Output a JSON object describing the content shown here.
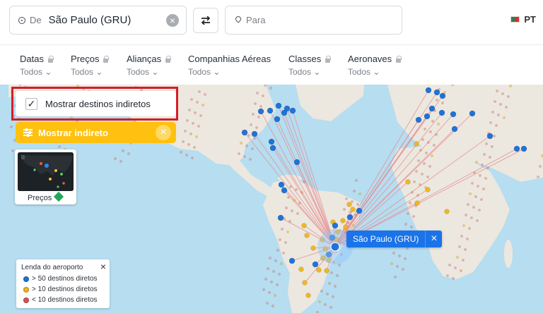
{
  "search": {
    "from_label": "De",
    "from_value": "São Paulo (GRU)",
    "to_placeholder": "Para"
  },
  "language": {
    "code": "PT"
  },
  "filters": [
    {
      "label": "Datas",
      "value": "Todos"
    },
    {
      "label": "Preços",
      "value": "Todos"
    },
    {
      "label": "Alianças",
      "value": "Todos"
    },
    {
      "label": "Companhias Aéreas",
      "value": "Todos"
    },
    {
      "label": "Classes",
      "value": "Todos"
    },
    {
      "label": "Aeronaves",
      "value": "Todos"
    }
  ],
  "panel": {
    "checkbox_label": "Mostrar destinos indiretos",
    "button_label": "Mostrar indireto"
  },
  "price_card": {
    "label": "Preços"
  },
  "map": {
    "selected_airport": "São Paulo (GRU)"
  },
  "legend": {
    "title": "Lenda do aeroporto",
    "items": [
      {
        "label": "> 50 destinos diretos",
        "color": "#1f73d9"
      },
      {
        "label": "> 10 destinos diretos",
        "color": "#f1b51a"
      },
      {
        "label": "< 10 destinos diretos",
        "color": "#d9534f"
      }
    ]
  },
  "colors": {
    "ocean": "#b6ddf0",
    "land": "#ebe7df",
    "route": "#e58e93",
    "highlight": "#d51d25",
    "accent": "#ffc110",
    "airport_tag": "#1a73e8"
  }
}
